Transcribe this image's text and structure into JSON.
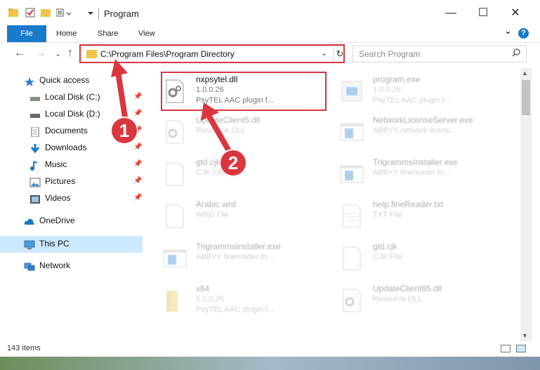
{
  "window": {
    "title": "Program",
    "minimize_glyph": "—",
    "maximize_glyph": "☐",
    "close_glyph": "✕"
  },
  "ribbon": {
    "tabs": [
      "File",
      "Home",
      "Share",
      "View"
    ],
    "expand_glyph": "⌄",
    "help_glyph": "?"
  },
  "navbar": {
    "back_glyph": "←",
    "forward_glyph": "→",
    "recent_glyph": "⌄",
    "up_glyph": "↑",
    "address": "C:\\Program Files\\Program Directory",
    "refresh_glyph": "↻",
    "search_placeholder": "Search Program",
    "search_glyph": "⚲"
  },
  "sidebar": {
    "items": [
      {
        "label": "Quick access",
        "icon": "star-icon"
      },
      {
        "label": "Local Disk (C:)",
        "icon": "drive-icon"
      },
      {
        "label": "Local Disk (D:)",
        "icon": "drive-icon"
      },
      {
        "label": "Documents",
        "icon": "documents-icon"
      },
      {
        "label": "Downloads",
        "icon": "download-icon"
      },
      {
        "label": "Music",
        "icon": "music-icon"
      },
      {
        "label": "Pictures",
        "icon": "pictures-icon"
      },
      {
        "label": "Videos",
        "icon": "videos-icon"
      },
      {
        "label": "OneDrive",
        "icon": "cloud-icon"
      },
      {
        "label": "This PC",
        "icon": "computer-icon"
      },
      {
        "label": "Network",
        "icon": "network-icon"
      }
    ],
    "pin_glyph": "📌"
  },
  "files": [
    {
      "name": "nxpsytel.dll",
      "line1": "1.0.0.26",
      "line2": "PsyTEL AAC plugin f...",
      "icon": "dll-gear-icon",
      "highlight": true
    },
    {
      "name": "program.exe",
      "line1": "1.0.0.26",
      "line2": "PsyTEL AAC plugin f...",
      "icon": "exe-icon"
    },
    {
      "name": "UpdateClient5.dll",
      "line1": "Resource DLL",
      "line2": "",
      "icon": "dll-gear-icon"
    },
    {
      "name": "NetworkLicenseServer.exe",
      "line1": "ABBYY network licens...",
      "line2": "",
      "icon": "exe-window-icon"
    },
    {
      "name": "gtd.cjk",
      "line1": "CJK File",
      "line2": "",
      "icon": "file-icon"
    },
    {
      "name": "TrigrammsInstaller.exe",
      "line1": "ABBYY finereader tri...",
      "line2": "",
      "icon": "exe-window-icon"
    },
    {
      "name": "Arabic.wrd",
      "line1": "WRD File",
      "line2": "",
      "icon": "file-icon"
    },
    {
      "name": "help.fineReader.txt",
      "line1": "TXT File",
      "line2": "",
      "icon": "text-file-icon"
    },
    {
      "name": "TrigrammsInstaller.exe",
      "line1": "ABBYY finereader tri...",
      "line2": "",
      "icon": "exe-window-icon"
    },
    {
      "name": "gtd.cjk",
      "line1": "CJK File",
      "line2": "",
      "icon": "file-icon"
    },
    {
      "name": "x64",
      "line1": "1.0.0.26",
      "line2": "PsyTEL AAC plugin f...",
      "icon": "folder-icon"
    },
    {
      "name": "UpdateClient65.dll",
      "line1": "Resource DLL",
      "line2": "",
      "icon": "dll-gear-icon"
    }
  ],
  "status": {
    "count": "143 items"
  },
  "annotations": [
    "1",
    "2"
  ],
  "colors": {
    "accent": "#1979ca",
    "highlight": "#d9363e",
    "selected_nav": "#cce8ff"
  }
}
